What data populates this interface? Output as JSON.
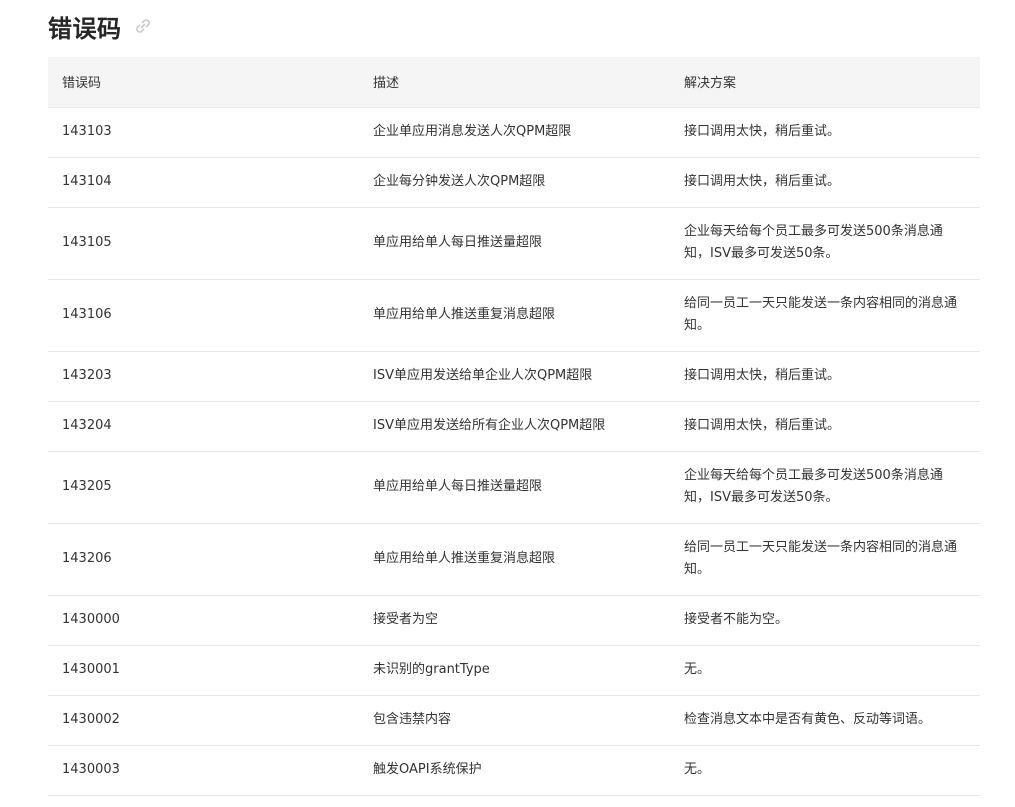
{
  "section": {
    "title": "错误码",
    "anchor_icon": "link-icon"
  },
  "table": {
    "headers": [
      "错误码",
      "描述",
      "解决方案"
    ],
    "rows": [
      {
        "code": "143103",
        "description": "企业单应用消息发送人次QPM超限",
        "solution": "接口调用太快，稍后重试。"
      },
      {
        "code": "143104",
        "description": "企业每分钟发送人次QPM超限",
        "solution": "接口调用太快，稍后重试。"
      },
      {
        "code": "143105",
        "description": "单应用给单人每日推送量超限",
        "solution": "企业每天给每个员工最多可发送500条消息通知，ISV最多可发送50条。"
      },
      {
        "code": "143106",
        "description": "单应用给单人推送重复消息超限",
        "solution": "给同一员工一天只能发送一条内容相同的消息通知。"
      },
      {
        "code": "143203",
        "description": "ISV单应用发送给单企业人次QPM超限",
        "solution": "接口调用太快，稍后重试。"
      },
      {
        "code": "143204",
        "description": "ISV单应用发送给所有企业人次QPM超限",
        "solution": "接口调用太快，稍后重试。"
      },
      {
        "code": "143205",
        "description": "单应用给单人每日推送量超限",
        "solution": "企业每天给每个员工最多可发送500条消息通知，ISV最多可发送50条。"
      },
      {
        "code": "143206",
        "description": "单应用给单人推送重复消息超限",
        "solution": "给同一员工一天只能发送一条内容相同的消息通知。"
      },
      {
        "code": "1430000",
        "description": "接受者为空",
        "solution": "接受者不能为空。"
      },
      {
        "code": "1430001",
        "description": "未识别的grantType",
        "solution": "无。"
      },
      {
        "code": "1430002",
        "description": "包含违禁内容",
        "solution": "检查消息文本中是否有黄色、反动等词语。"
      },
      {
        "code": "1430003",
        "description": "触发OAPI系统保护",
        "solution": "无。"
      }
    ]
  }
}
